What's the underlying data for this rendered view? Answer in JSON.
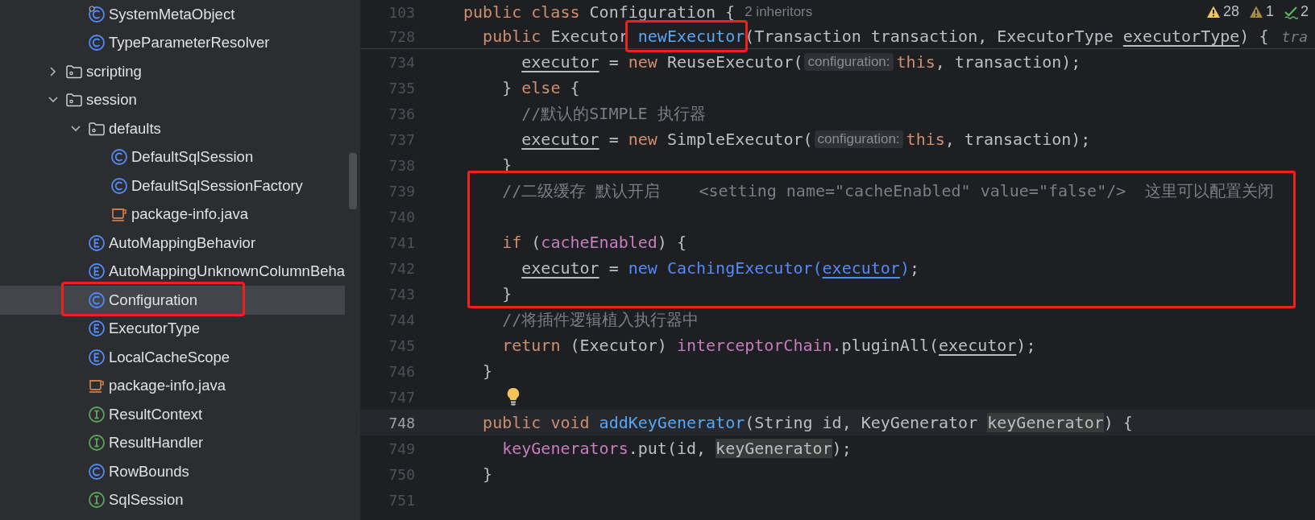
{
  "project_tree": {
    "items_above": [
      {
        "label": "SystemMetaObject",
        "kind": "class",
        "decorated": true,
        "selected": false,
        "boxed": false
      },
      {
        "label": "TypeParameterResolver",
        "kind": "class",
        "decorated": false,
        "selected": false,
        "boxed": false
      }
    ],
    "items": [
      {
        "label": "scripting",
        "kind": "folder",
        "expanded": false,
        "selected": false,
        "boxed": false
      },
      {
        "label": "session",
        "kind": "folder",
        "expanded": true,
        "selected": false,
        "boxed": false,
        "children": [
          {
            "label": "defaults",
            "kind": "folder",
            "expanded": true,
            "selected": false,
            "boxed": false,
            "children": [
              {
                "label": "DefaultSqlSession",
                "kind": "class",
                "selected": false,
                "boxed": false
              },
              {
                "label": "DefaultSqlSessionFactory",
                "kind": "class",
                "selected": false,
                "boxed": false
              },
              {
                "label": "package-info.java",
                "kind": "java_file",
                "selected": false,
                "boxed": false
              }
            ]
          },
          {
            "label": "AutoMappingBehavior",
            "kind": "enum",
            "selected": false,
            "boxed": false
          },
          {
            "label": "AutoMappingUnknownColumnBeha",
            "kind": "enum",
            "selected": false,
            "boxed": false
          },
          {
            "label": "Configuration",
            "kind": "class",
            "selected": true,
            "boxed": true
          },
          {
            "label": "ExecutorType",
            "kind": "enum",
            "selected": false,
            "boxed": false
          },
          {
            "label": "LocalCacheScope",
            "kind": "enum",
            "selected": false,
            "boxed": false
          },
          {
            "label": "package-info.java",
            "kind": "java_file",
            "selected": false,
            "boxed": false
          },
          {
            "label": "ResultContext",
            "kind": "interface",
            "selected": false,
            "boxed": false
          },
          {
            "label": "ResultHandler",
            "kind": "interface",
            "selected": false,
            "boxed": false
          },
          {
            "label": "RowBounds",
            "kind": "class",
            "selected": false,
            "boxed": false
          },
          {
            "label": "SqlSession",
            "kind": "interface",
            "selected": false,
            "boxed": false
          }
        ]
      }
    ]
  },
  "editor": {
    "inspections": [
      {
        "kind": "warning",
        "count": "28"
      },
      {
        "kind": "weak_warning",
        "count": "1"
      },
      {
        "kind": "typo",
        "count": "2"
      }
    ],
    "sticky_lines": [
      {
        "number": "103",
        "tokens": [
          {
            "kind": "keyword",
            "text": "public class "
          },
          {
            "kind": "plain",
            "text": "Configuration {"
          },
          {
            "kind": "inlay",
            "text": "2 inheritors"
          }
        ]
      },
      {
        "number": "728",
        "tokens": [
          {
            "kind": "keyword",
            "text": "  public "
          },
          {
            "kind": "plain",
            "text": "Executor "
          },
          {
            "kind": "method",
            "text": "newExecutor",
            "boxed": true
          },
          {
            "kind": "plain",
            "text": "(Transaction transaction, ExecutorType "
          },
          {
            "kind": "underlined",
            "text": "executorType"
          },
          {
            "kind": "plain",
            "text": ") {"
          },
          {
            "kind": "inlay_italic",
            "text": "tra"
          }
        ]
      }
    ],
    "lines": [
      {
        "kind": "code",
        "number": "734",
        "current": false,
        "tokens": [
          {
            "kind": "underlined",
            "text": "      executor"
          },
          {
            "kind": "plain",
            "text": " = "
          },
          {
            "kind": "keyword",
            "text": "new"
          },
          {
            "kind": "plain",
            "text": " ReuseExecutor("
          },
          {
            "kind": "hint",
            "text": "configuration:"
          },
          {
            "kind": "keyword",
            "text": "this"
          },
          {
            "kind": "plain",
            "text": ", transaction);"
          }
        ]
      },
      {
        "kind": "code",
        "number": "735",
        "current": false,
        "tokens": [
          {
            "kind": "plain",
            "text": "    } "
          },
          {
            "kind": "keyword",
            "text": "else"
          },
          {
            "kind": "plain",
            "text": " {"
          }
        ]
      },
      {
        "kind": "code",
        "number": "736",
        "current": false,
        "tokens": [
          {
            "kind": "comment",
            "text": "      //默认的SIMPLE 执行器"
          }
        ]
      },
      {
        "kind": "code",
        "number": "737",
        "current": false,
        "tokens": [
          {
            "kind": "underlined",
            "text": "      executor"
          },
          {
            "kind": "plain",
            "text": " = "
          },
          {
            "kind": "keyword",
            "text": "new"
          },
          {
            "kind": "plain",
            "text": " SimpleExecutor("
          },
          {
            "kind": "hint",
            "text": "configuration:"
          },
          {
            "kind": "keyword",
            "text": "this"
          },
          {
            "kind": "plain",
            "text": ", transaction);"
          }
        ]
      },
      {
        "kind": "code",
        "number": "738",
        "current": false,
        "tokens": [
          {
            "kind": "plain",
            "text": "    }"
          }
        ]
      },
      {
        "kind": "boxed_block",
        "lines": [
          {
            "kind": "code",
            "number": "739",
            "current": false,
            "tokens": [
              {
                "kind": "comment",
                "text": "    //二级缓存 默认开启    <setting name=\"cacheEnabled\" value=\"false\"/>  这里可以配置关闭"
              }
            ]
          },
          {
            "kind": "code",
            "number": "740",
            "current": false
          },
          {
            "kind": "code",
            "number": "741",
            "current": false,
            "tokens": [
              {
                "kind": "keyword",
                "text": "    if"
              },
              {
                "kind": "plain",
                "text": " ("
              },
              {
                "kind": "field",
                "text": "cacheEnabled"
              },
              {
                "kind": "plain",
                "text": ") {"
              }
            ]
          },
          {
            "kind": "code",
            "number": "742",
            "current": false,
            "tokens": [
              {
                "kind": "underlined",
                "text": "      executor"
              },
              {
                "kind": "plain",
                "text": " = "
              },
              {
                "kind": "link",
                "text": "new CachingExecutor("
              },
              {
                "kind": "link_underlined",
                "text": "executor"
              },
              {
                "kind": "link",
                "text": ")"
              },
              {
                "kind": "plain",
                "text": ";"
              }
            ]
          },
          {
            "kind": "code",
            "number": "743",
            "current": false,
            "tokens": [
              {
                "kind": "plain",
                "text": "    }"
              }
            ]
          }
        ]
      },
      {
        "kind": "code",
        "number": "744",
        "current": false,
        "tokens": [
          {
            "kind": "comment",
            "text": "    //将插件逻辑植入执行器中"
          }
        ]
      },
      {
        "kind": "code",
        "number": "745",
        "current": false,
        "tokens": [
          {
            "kind": "keyword",
            "text": "    return"
          },
          {
            "kind": "plain",
            "text": " (Executor) "
          },
          {
            "kind": "field",
            "text": "interceptorChain"
          },
          {
            "kind": "plain",
            "text": ".pluginAll("
          },
          {
            "kind": "underlined",
            "text": "executor"
          },
          {
            "kind": "plain",
            "text": ");"
          }
        ]
      },
      {
        "kind": "code",
        "number": "746",
        "current": false,
        "tokens": [
          {
            "kind": "plain",
            "text": "  }"
          }
        ]
      },
      {
        "kind": "bulb",
        "number": "747",
        "current": false
      },
      {
        "kind": "code",
        "number": "748",
        "current": true,
        "tokens": [
          {
            "kind": "keyword",
            "text": "  public void "
          },
          {
            "kind": "method",
            "text": "addKeyGenerator"
          },
          {
            "kind": "plain",
            "text": "(String id, KeyGenerator "
          },
          {
            "kind": "occurrence",
            "text": "keyGenerator"
          },
          {
            "kind": "plain",
            "text": ") {"
          }
        ]
      },
      {
        "kind": "code",
        "number": "749",
        "current": false,
        "tokens": [
          {
            "kind": "field",
            "text": "    keyGenerators"
          },
          {
            "kind": "plain",
            "text": ".put(id, "
          },
          {
            "kind": "occurrence",
            "text": "keyGenerator"
          },
          {
            "kind": "plain",
            "text": ");"
          }
        ]
      },
      {
        "kind": "code",
        "number": "750",
        "current": false,
        "tokens": [
          {
            "kind": "plain",
            "text": "  }"
          }
        ]
      },
      {
        "kind": "code",
        "number": "751",
        "current": false
      }
    ]
  }
}
